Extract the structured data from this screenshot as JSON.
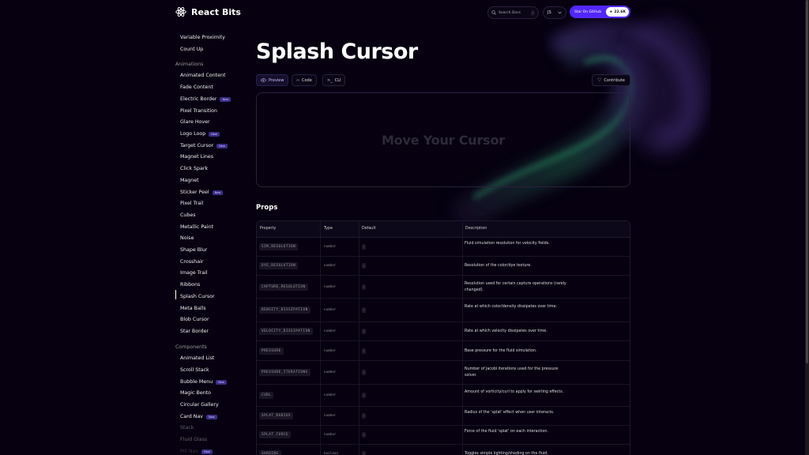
{
  "header": {
    "logo_text": "React Bits",
    "search_placeholder": "Search Docs",
    "search_shortcut": "/",
    "language": "JS",
    "github_label": "Star On GitHub",
    "github_stars": "22.6K"
  },
  "sidebar": {
    "items": [
      {
        "label": "Variable Proximity",
        "type": "item"
      },
      {
        "label": "Count Up",
        "type": "item"
      },
      {
        "label": "Animations",
        "type": "category"
      },
      {
        "label": "Animated Content",
        "type": "item"
      },
      {
        "label": "Fade Content",
        "type": "item"
      },
      {
        "label": "Electric Border",
        "type": "item",
        "badge": "New"
      },
      {
        "label": "Pixel Transition",
        "type": "item"
      },
      {
        "label": "Glare Hover",
        "type": "item"
      },
      {
        "label": "Logo Loop",
        "type": "item",
        "badge": "New"
      },
      {
        "label": "Target Cursor",
        "type": "item",
        "badge": "New"
      },
      {
        "label": "Magnet Lines",
        "type": "item"
      },
      {
        "label": "Click Spark",
        "type": "item"
      },
      {
        "label": "Magnet",
        "type": "item"
      },
      {
        "label": "Sticker Peel",
        "type": "item",
        "badge": "New"
      },
      {
        "label": "Pixel Trail",
        "type": "item"
      },
      {
        "label": "Cubes",
        "type": "item"
      },
      {
        "label": "Metallic Paint",
        "type": "item"
      },
      {
        "label": "Noise",
        "type": "item"
      },
      {
        "label": "Shape Blur",
        "type": "item"
      },
      {
        "label": "Crosshair",
        "type": "item"
      },
      {
        "label": "Image Trail",
        "type": "item"
      },
      {
        "label": "Ribbons",
        "type": "item"
      },
      {
        "label": "Splash Cursor",
        "type": "item",
        "active": true
      },
      {
        "label": "Meta Balls",
        "type": "item"
      },
      {
        "label": "Blob Cursor",
        "type": "item"
      },
      {
        "label": "Star Border",
        "type": "item"
      },
      {
        "label": "Components",
        "type": "category"
      },
      {
        "label": "Animated List",
        "type": "item"
      },
      {
        "label": "Scroll Stack",
        "type": "item"
      },
      {
        "label": "Bubble Menu",
        "type": "item",
        "badge": "New"
      },
      {
        "label": "Magic Bento",
        "type": "item"
      },
      {
        "label": "Circular Gallery",
        "type": "item"
      },
      {
        "label": "Card Nav",
        "type": "item",
        "badge": "New"
      },
      {
        "label": "Stack",
        "type": "item"
      },
      {
        "label": "Fluid Glass",
        "type": "item"
      },
      {
        "label": "Pill Nav",
        "type": "item",
        "badge": "New"
      }
    ]
  },
  "main": {
    "title": "Splash Cursor",
    "tabs": [
      "Preview",
      "Code",
      "CLI"
    ],
    "active_tab": "Preview",
    "contribute_label": "Contribute",
    "preview_text": "Move Your Cursor",
    "props_heading": "Props",
    "table_headers": [
      "Property",
      "Type",
      "Default",
      "Description"
    ],
    "rows": [
      {
        "property": "SIM_RESOLUTION",
        "type": "number",
        "default": "-",
        "description": "Fluid simulation resolution for velocity fields."
      },
      {
        "property": "DYE_RESOLUTION",
        "type": "number",
        "default": "-",
        "description": "Resolution of the color/dye texture."
      },
      {
        "property": "CAPTURE_RESOLUTION",
        "type": "number",
        "default": "-",
        "description": "Resolution used for certain capture operations (rarely changed)."
      },
      {
        "property": "DENSITY_DISSIPATION",
        "type": "number",
        "default": "-",
        "description": "Rate at which color/density dissipates over time."
      },
      {
        "property": "VELOCITY_DISSIPATION",
        "type": "number",
        "default": "-",
        "description": "Rate at which velocity dissipates over time."
      },
      {
        "property": "PRESSURE",
        "type": "number",
        "default": "-",
        "description": "Base pressure for the fluid simulation."
      },
      {
        "property": "PRESSURE_ITERATIONS",
        "type": "number",
        "default": "-",
        "description": "Number of Jacobi iterations used for the pressure solver."
      },
      {
        "property": "CURL",
        "type": "number",
        "default": "-",
        "description": "Amount of vorticity/curl to apply for swirling effects."
      },
      {
        "property": "SPLAT_RADIUS",
        "type": "number",
        "default": "-",
        "description": "Radius of the 'splat' effect when user interacts."
      },
      {
        "property": "SPLAT_FORCE",
        "type": "number",
        "default": "-",
        "description": "Force of the fluid 'splat' on each interaction."
      },
      {
        "property": "SHADING",
        "type": "boolean",
        "default": "-",
        "description": "Toggles simple lighting/shading on the fluid."
      }
    ]
  },
  "colors": {
    "background": "#060010",
    "accent": "#5227ff"
  }
}
